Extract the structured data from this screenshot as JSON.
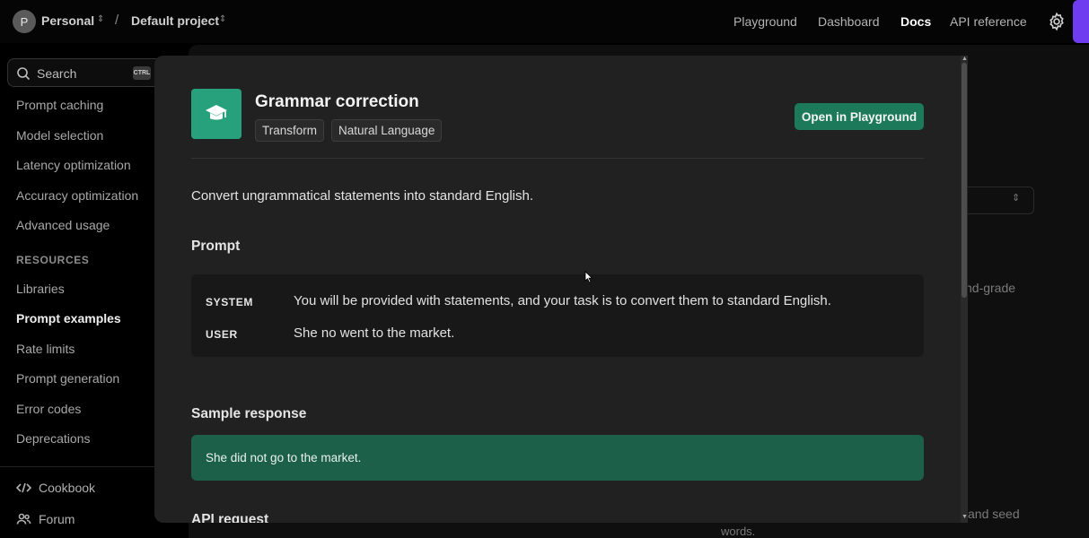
{
  "topbar": {
    "org_initial": "P",
    "org_name": "Personal",
    "project_name": "Default project",
    "separator": "/",
    "nav": [
      "Playground",
      "Dashboard",
      "Docs",
      "API reference"
    ],
    "active_nav": "Docs"
  },
  "sidebar": {
    "search_label": "Search",
    "shortcut": "CTRL",
    "items": [
      "Prompt caching",
      "Model selection",
      "Latency optimization",
      "Accuracy optimization",
      "Advanced usage"
    ],
    "resources_heading": "RESOURCES",
    "resources": [
      "Libraries",
      "Prompt examples",
      "Rate limits",
      "Prompt generation",
      "Error codes",
      "Deprecations"
    ],
    "active_item": "Prompt examples",
    "bottom_links": [
      "Cookbook",
      "Forum"
    ]
  },
  "background": {
    "fragment_1": "nd-grade",
    "fragment_2": "and seed",
    "fragment_3": "words."
  },
  "modal": {
    "title": "Grammar correction",
    "tags": [
      "Transform",
      "Natural Language"
    ],
    "open_button": "Open in Playground",
    "description": "Convert ungrammatical statements into standard English.",
    "prompt_heading": "Prompt",
    "messages": [
      {
        "role": "SYSTEM",
        "text": "You will be provided with statements, and your task is to convert them to standard English."
      },
      {
        "role": "USER",
        "text": "She no went to the market."
      }
    ],
    "sample_heading": "Sample response",
    "sample_response": "She did not go to the market.",
    "api_heading": "API request"
  },
  "colors": {
    "accent_green": "#26a17b",
    "button_green": "#1c7a5a",
    "response_green": "#1d6049",
    "brand_purple": "#6f3cf0"
  }
}
